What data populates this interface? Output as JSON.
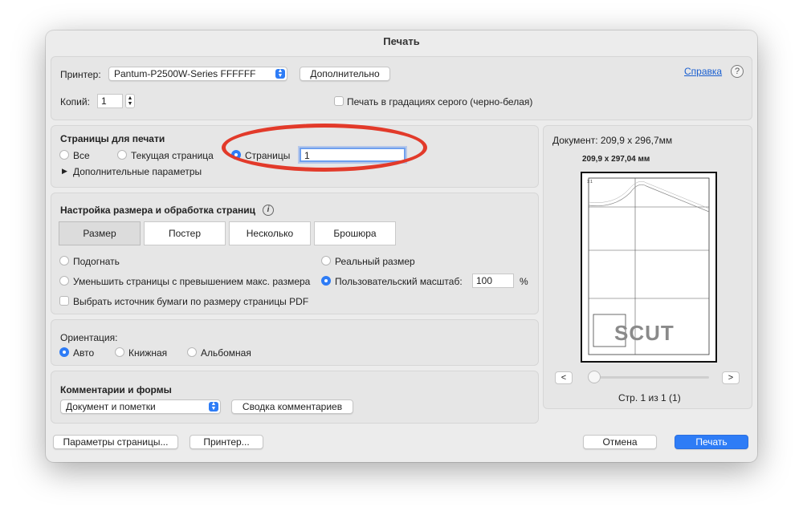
{
  "window": {
    "title": "Печать"
  },
  "printer": {
    "label": "Принтер:",
    "selected": "Pantum-P2500W-Series FFFFFF",
    "details_button": "Дополнительно",
    "help_link": "Справка",
    "help_icon": "?"
  },
  "copies": {
    "label": "Копий:",
    "value": "1",
    "grayscale_label": "Печать в градациях серого (черно-белая)",
    "grayscale_checked": false
  },
  "pages_section": {
    "title": "Страницы для печати",
    "options": [
      "Все",
      "Текущая страница",
      "Страницы"
    ],
    "selected": "Страницы",
    "range_value": "1",
    "more_options": "Дополнительные параметры",
    "annotation_color": "#e23a2a"
  },
  "sizing_section": {
    "title": "Настройка размера и обработка страниц",
    "info_icon": "i",
    "tabs": [
      "Размер",
      "Постер",
      "Несколько",
      "Брошюра"
    ],
    "active_tab": "Размер",
    "fit_label": "Подогнать",
    "shrink_label": "Уменьшить страницы с превышением макс. размера",
    "pdf_source_label": "Выбрать источник бумаги по размеру страницы PDF",
    "actual_size_label": "Реальный размер",
    "custom_scale_label": "Пользовательский масштаб:",
    "custom_scale_value": "100",
    "custom_scale_unit": "%",
    "selected": "Пользовательский масштаб:"
  },
  "orientation_section": {
    "label": "Ориентация:",
    "options": [
      "Авто",
      "Книжная",
      "Альбомная"
    ],
    "selected": "Авто"
  },
  "comments_section": {
    "title": "Комментарии и формы",
    "selected": "Документ и пометки",
    "summary_button": "Сводка комментариев"
  },
  "preview": {
    "document_size": "Документ: 209,9 x 296,7мм",
    "page_size": "209,9 x 297,04 мм",
    "prev": "<",
    "next": ">",
    "page_label": "Стр. 1 из 1 (1)",
    "stamp_text": "SCUT"
  },
  "footer": {
    "page_setup": "Параметры страницы...",
    "printer": "Принтер...",
    "cancel": "Отмена",
    "print": "Печать"
  },
  "colors": {
    "accent": "#2e7cf6",
    "annotation": "#e23a2a"
  }
}
